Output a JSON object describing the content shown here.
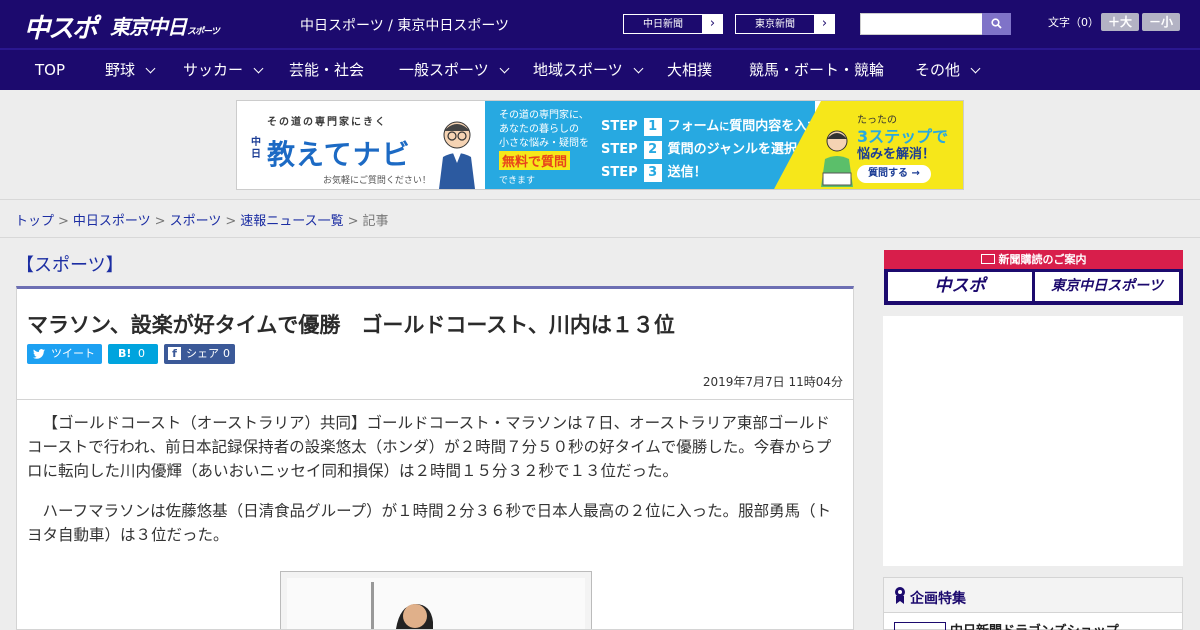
{
  "header": {
    "logo_chuspo": "中スポ",
    "logo_tokyo": "東京中日",
    "logo_tokyo_small": "スポーツ",
    "site_title": "中日スポーツ / 東京中日スポーツ",
    "link_chunichi": "中日新聞",
    "link_tokyo": "東京新聞",
    "search_placeholder": "",
    "font_label": "文字（0）",
    "font_larger": "＋大",
    "font_smaller": "－小"
  },
  "nav": {
    "items": [
      {
        "label": "TOP"
      },
      {
        "label": "野球"
      },
      {
        "label": "サッカー"
      },
      {
        "label": "芸能・社会"
      },
      {
        "label": "一般スポーツ"
      },
      {
        "label": "地域スポーツ"
      },
      {
        "label": "大相撲"
      },
      {
        "label": "競馬・ボート・競輪"
      },
      {
        "label": "その他"
      }
    ]
  },
  "banner": {
    "tagline": "その道の専門家にきく",
    "brand_small": "中日",
    "brand_main": "教えてナビ",
    "brand_sub": "お気軽にご質問ください！",
    "intro_line1": "その道の専門家に、",
    "intro_line2": "あなたの暮らしの",
    "intro_line3": "小さな悩み・疑問を",
    "free": "無料で質問",
    "dekimasu": "できます",
    "step_word": "STEP",
    "steps": [
      {
        "num": "1",
        "pre": "フォーム",
        "mid": "に",
        "post": "質問内容を入力"
      },
      {
        "num": "2",
        "pre": "質問の",
        "mid": "",
        "post": "ジャンルを選択"
      },
      {
        "num": "3",
        "pre": "送信！",
        "mid": "",
        "post": ""
      }
    ],
    "right_t1": "たったの",
    "right_t2": "3ステップで",
    "right_t3": "悩みを解消！",
    "right_btn": "質問する →"
  },
  "breadcrumb": {
    "items": [
      "トップ",
      "中日スポーツ",
      "スポーツ",
      "速報ニュース一覧"
    ],
    "sep": ">",
    "current": "記事"
  },
  "article": {
    "category": "【スポーツ】",
    "title": "マラソン、設楽が好タイムで優勝　ゴールドコースト、川内は１３位",
    "tweet_label": "ツイート",
    "hatena_icon": "B!",
    "hatena_count": "0",
    "fb_label": "シェア",
    "fb_count": "0",
    "date": "2019年7月7日 11時04分",
    "paragraph1": "【ゴールドコースト（オーストラリア）共同】ゴールドコースト・マラソンは７日、オーストラリア東部ゴールドコーストで行われ、前日本記録保持者の設楽悠太（ホンダ）が２時間７分５０秒の好タイムで優勝した。今春からプロに転向した川内優輝（あいおいニッセイ同和損保）は２時間１５分３２秒で１３位だった。",
    "paragraph2": "ハーフマラソンは佐藤悠基（日清食品グループ）が１時間２分３６秒で日本人最高の２位に入った。服部勇馬（トヨタ自動車）は３位だった。"
  },
  "sidebar": {
    "subscribe_head": "新聞購読のご案内",
    "sub_logo1": "中スポ",
    "sub_logo2": "東京中日スポーツ",
    "feature_title": "企画特集",
    "feature_item": "中日新聞ドラゴンズショップ"
  },
  "colors": {
    "brand_navy": "#1c0a6e",
    "accent_red": "#d81e4b",
    "link_blue": "#1c2ea3",
    "twitter": "#1da1f2",
    "hatena": "#00a4de",
    "facebook": "#3b5998"
  }
}
